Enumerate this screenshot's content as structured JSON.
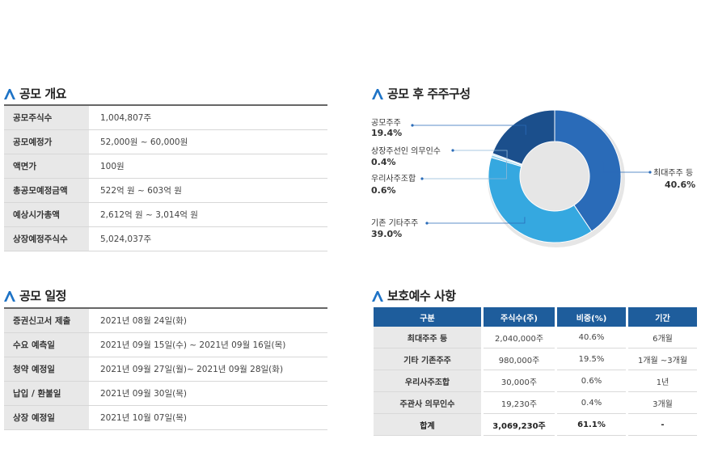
{
  "offering_overview": {
    "title": "공모 개요",
    "rows": [
      {
        "label": "공모주식수",
        "value": "1,004,807주"
      },
      {
        "label": "공모예정가",
        "value": "52,000원 ~ 60,000원"
      },
      {
        "label": "액면가",
        "value": "100원"
      },
      {
        "label": "총공모예정금액",
        "value": "522억 원 ~ 603억 원"
      },
      {
        "label": "예상시가총액",
        "value": "2,612억 원 ~ 3,014억 원"
      },
      {
        "label": "상장예정주식수",
        "value": "5,024,037주"
      }
    ]
  },
  "offering_schedule": {
    "title": "공모 일정",
    "rows": [
      {
        "label": "증권신고서 제출",
        "value": "2021년 08월 24일(화)"
      },
      {
        "label": "수요 예측일",
        "value": "2021년 09월 15일(수) ~ 2021년 09월 16일(목)"
      },
      {
        "label": "청약 예정일",
        "value": "2021년 09월 27일(월)~ 2021년 09월 28일(화)"
      },
      {
        "label": "납입 / 환불일",
        "value": "2021년 09월 30일(목)"
      },
      {
        "label": "상장 예정일",
        "value": "2021년 10월 07일(목)"
      }
    ]
  },
  "shareholder_composition": {
    "title": "공모 후 주주구성",
    "colors": {
      "largest": "#2a6bb8",
      "existing_other": "#35a8e0",
      "esop": "#8fd0ef",
      "underwriter": "#c9e9f7",
      "public": "#1b4f8c"
    }
  },
  "chart_data": {
    "type": "pie",
    "categories": [
      "최대주주 등",
      "기존 기타주주",
      "우리사주조합",
      "상장주선인 의무인수",
      "공모주주"
    ],
    "values": [
      40.6,
      39.0,
      0.6,
      0.4,
      19.4
    ],
    "value_labels": [
      "40.6%",
      "39.0%",
      "0.6%",
      "0.4%",
      "19.4%"
    ],
    "donut": true
  },
  "lockup": {
    "title": "보호예수 사항",
    "headers": [
      "구분",
      "주식수(주)",
      "비중(%)",
      "기간"
    ],
    "rows": [
      [
        "최대주주 등",
        "2,040,000주",
        "40.6%",
        "6개월"
      ],
      [
        "기타 기존주주",
        "980,000주",
        "19.5%",
        "1개월 ~3개월"
      ],
      [
        "우리사주조합",
        "30,000주",
        "0.6%",
        "1년"
      ],
      [
        "주관사 의무인수",
        "19,230주",
        "0.4%",
        "3개월"
      ],
      [
        "합계",
        "3,069,230주",
        "61.1%",
        "-"
      ]
    ]
  }
}
